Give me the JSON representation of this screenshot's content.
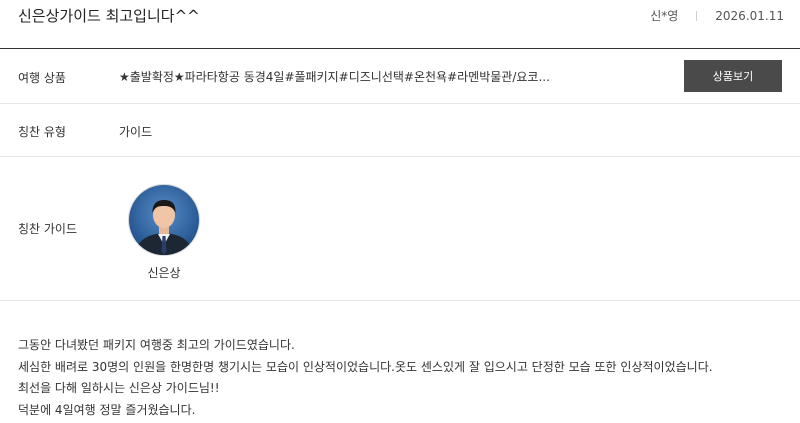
{
  "review": {
    "title": "신은상가이드 최고입니다^^",
    "author": "신*영",
    "date": "2026.01.11"
  },
  "product": {
    "label": "여행 상품",
    "value": "★출발확정★파라타항공 동경4일#풀패키지#디즈니선택#온천욕#라멘박물관/요코...",
    "button_label": "상품보기"
  },
  "praise_type": {
    "label": "칭찬 유형",
    "value": "가이드"
  },
  "praise_guide": {
    "label": "칭찬 가이드",
    "guide_name": "신은상"
  },
  "body": {
    "lines": [
      "그동안 다녀봤던 패키지 여행중 최고의 가이드였습니다.",
      "세심한 배려로 30명의 인원을 한명한명 챙기시는 모습이 인상적이었습니다.옷도 센스있게 잘 입으시고 단정한 모습 또한 인상적이었습니다.",
      "최선을 다해 일하시는 신은상 가이드님!!",
      "덕분에 4일여행 정말 즐거웠습니다."
    ]
  },
  "colors": {
    "button_bg": "#4a4a4a",
    "header_rule": "#333333",
    "row_divider": "#e5e5e5"
  }
}
